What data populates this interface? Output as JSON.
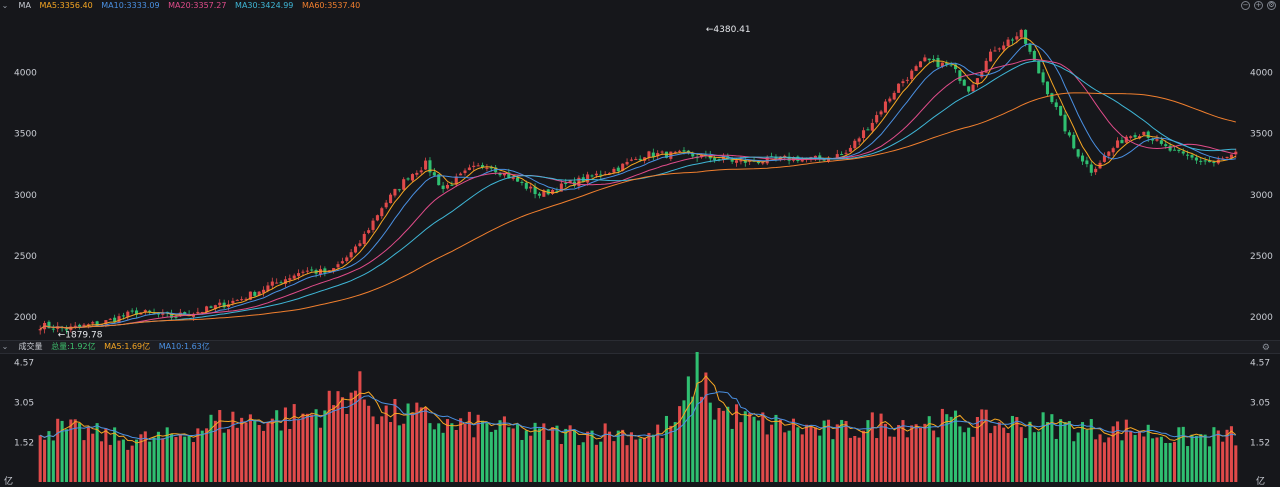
{
  "header": {
    "indicator": "MA",
    "items": [
      {
        "label": "MA5:3356.40",
        "color": "#f5a623"
      },
      {
        "label": "MA10:3333.09",
        "color": "#4a90e2"
      },
      {
        "label": "MA20:3357.27",
        "color": "#e04c8a"
      },
      {
        "label": "MA30:3424.99",
        "color": "#3fb6d6"
      },
      {
        "label": "MA60:3537.40",
        "color": "#f07f2e"
      }
    ],
    "tool_icons": [
      "minus-icon",
      "plus-icon",
      "gear-icon"
    ]
  },
  "volume_header": {
    "title": "成交量",
    "items": [
      {
        "label": "总量:1.92亿",
        "color": "#3ec06d"
      },
      {
        "label": "MA5:1.69亿",
        "color": "#f5a623"
      },
      {
        "label": "MA10:1.63亿",
        "color": "#4a90e2"
      }
    ]
  },
  "colors": {
    "up": "#e04a4a",
    "down": "#2fbf71",
    "background": "#16171b",
    "text": "#c9ccd3"
  },
  "chart_data": [
    {
      "type": "candlestick",
      "price_ticks": [
        "4000",
        "3500",
        "3000",
        "2500",
        "2000"
      ],
      "price_tick_values": [
        4000,
        3500,
        3000,
        2500,
        2000
      ],
      "ylim": [
        1860,
        4480
      ],
      "annotations": [
        {
          "text": "←4380.41",
          "value": 4380.41,
          "x_index": 152
        },
        {
          "text": "←1879.78",
          "value": 1879.78,
          "x_index": 4
        }
      ],
      "close_keypoints": [
        [
          0,
          1930
        ],
        [
          6,
          1900
        ],
        [
          14,
          1950
        ],
        [
          22,
          2040
        ],
        [
          30,
          2000
        ],
        [
          38,
          2060
        ],
        [
          46,
          2150
        ],
        [
          54,
          2280
        ],
        [
          60,
          2380
        ],
        [
          66,
          2360
        ],
        [
          72,
          2550
        ],
        [
          78,
          2900
        ],
        [
          84,
          3150
        ],
        [
          88,
          3250
        ],
        [
          92,
          3050
        ],
        [
          98,
          3200
        ],
        [
          102,
          3250
        ],
        [
          108,
          3130
        ],
        [
          114,
          3000
        ],
        [
          120,
          3080
        ],
        [
          126,
          3150
        ],
        [
          132,
          3220
        ],
        [
          138,
          3330
        ],
        [
          146,
          3330
        ],
        [
          154,
          3300
        ],
        [
          160,
          3270
        ],
        [
          166,
          3280
        ],
        [
          172,
          3300
        ],
        [
          178,
          3290
        ],
        [
          184,
          3340
        ],
        [
          190,
          3600
        ],
        [
          196,
          3900
        ],
        [
          202,
          4100
        ],
        [
          208,
          4050
        ],
        [
          212,
          3870
        ],
        [
          218,
          4200
        ],
        [
          224,
          4320
        ],
        [
          228,
          4000
        ],
        [
          232,
          3700
        ],
        [
          236,
          3380
        ],
        [
          240,
          3200
        ],
        [
          244,
          3350
        ],
        [
          248,
          3480
        ],
        [
          252,
          3520
        ],
        [
          256,
          3400
        ],
        [
          260,
          3330
        ],
        [
          264,
          3290
        ],
        [
          268,
          3260
        ],
        [
          273,
          3330
        ]
      ],
      "candle_count": 274,
      "ma_series": [
        {
          "name": "MA5",
          "period": 5,
          "color": "#f5a623"
        },
        {
          "name": "MA10",
          "period": 10,
          "color": "#4a90e2"
        },
        {
          "name": "MA20",
          "period": 20,
          "color": "#e04c8a"
        },
        {
          "name": "MA30",
          "period": 30,
          "color": "#3fb6d6"
        },
        {
          "name": "MA60",
          "period": 60,
          "color": "#f07f2e"
        }
      ]
    },
    {
      "type": "bar",
      "title": "成交量",
      "unit": "亿",
      "volume_ticks": [
        "4.57",
        "3.05",
        "1.52"
      ],
      "volume_tick_values": [
        4.57,
        3.05,
        1.52
      ],
      "ylim": [
        0,
        4.75
      ],
      "volume_keypoints": [
        [
          0,
          2.1
        ],
        [
          10,
          1.9
        ],
        [
          20,
          1.6
        ],
        [
          30,
          1.7
        ],
        [
          40,
          2.3
        ],
        [
          50,
          2.4
        ],
        [
          60,
          2.5
        ],
        [
          66,
          2.9
        ],
        [
          72,
          3.6
        ],
        [
          78,
          2.6
        ],
        [
          86,
          2.5
        ],
        [
          94,
          2.1
        ],
        [
          100,
          2.2
        ],
        [
          110,
          1.9
        ],
        [
          120,
          1.85
        ],
        [
          130,
          1.9
        ],
        [
          140,
          1.8
        ],
        [
          146,
          2.4
        ],
        [
          150,
          4.5
        ],
        [
          154,
          2.8
        ],
        [
          162,
          2.3
        ],
        [
          172,
          2.1
        ],
        [
          182,
          1.9
        ],
        [
          190,
          2.2
        ],
        [
          200,
          2.3
        ],
        [
          210,
          2.25
        ],
        [
          220,
          2.2
        ],
        [
          230,
          2.2
        ],
        [
          240,
          2.0
        ],
        [
          250,
          2.0
        ],
        [
          260,
          1.7
        ],
        [
          273,
          1.75
        ]
      ]
    }
  ]
}
